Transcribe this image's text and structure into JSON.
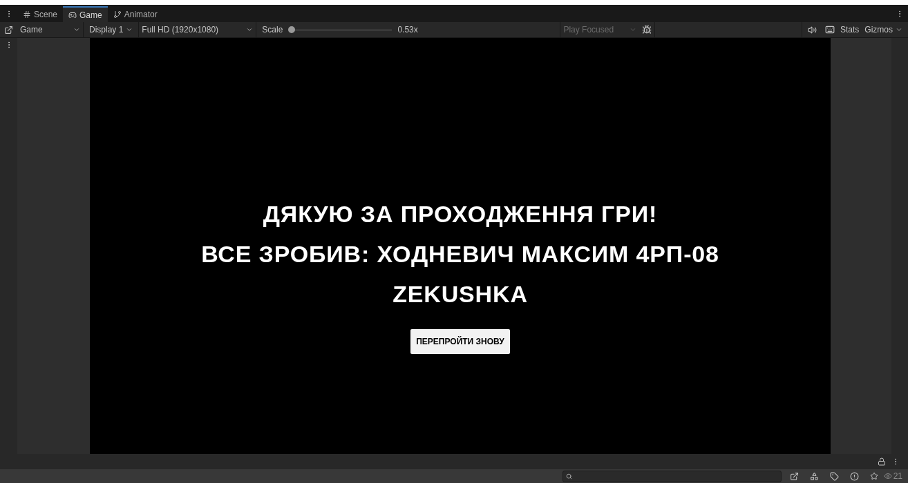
{
  "tabs": [
    {
      "label": "Scene",
      "selected": false
    },
    {
      "label": "Game",
      "selected": true
    },
    {
      "label": "Animator",
      "selected": false
    }
  ],
  "toolbar": {
    "view": "Game",
    "display": "Display 1",
    "resolution": "Full HD (1920x1080)",
    "scale_label": "Scale",
    "scale": {
      "level": 0.03
    },
    "scale_reading": "0.53x",
    "play_mode": {
      "label": "Play Focused",
      "disabled": true
    },
    "stats": "Stats",
    "gizmos": "Gizmos"
  },
  "game": {
    "lines": [
      "ДЯКУЮ ЗА ПРОХОДЖЕННЯ ГРИ!",
      "ВСЕ ЗРОБИВ: ХОДНЕВИЧ МАКСИМ 4РП-08",
      "ZEKUSHKA"
    ],
    "button": "ПЕРЕПРОЙТИ ЗНОВУ"
  },
  "status_bar": {
    "visible_count": "21"
  }
}
